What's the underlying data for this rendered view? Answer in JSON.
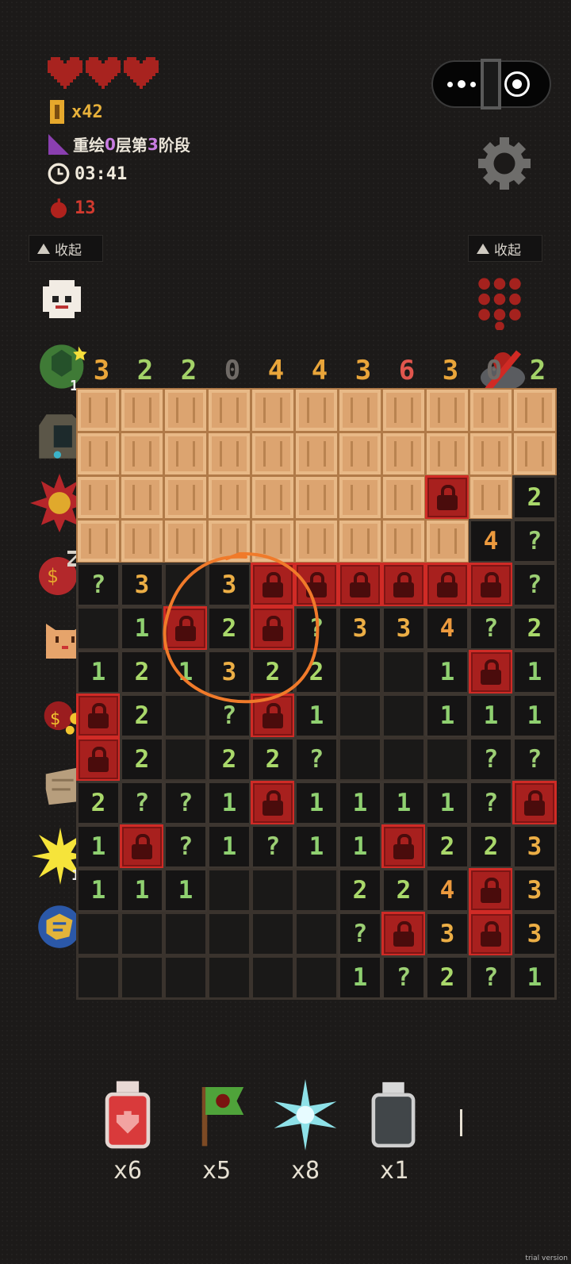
{
  "hud": {
    "coins": "x42",
    "level_text": [
      "重绘",
      "0",
      "层第",
      "3",
      "阶段"
    ],
    "timer": "03:41",
    "bombs": "13"
  },
  "panels": {
    "left_collapse": "收起",
    "right_collapse": "收起"
  },
  "left_badges": {
    "shield": "1",
    "lightning": "1"
  },
  "column_numbers": [
    "3",
    "2",
    "2",
    "0",
    "4",
    "4",
    "3",
    "6",
    "3",
    "0",
    "2"
  ],
  "column_colors": [
    "#e9a53a",
    "#a3d268",
    "#a3d268",
    "#6f6a66",
    "#e9a53a",
    "#e9a53a",
    "#e9a53a",
    "#e0564d",
    "#e9a53a",
    "#6f6a66",
    "#a3d268"
  ],
  "board": [
    [
      "W",
      "W",
      "W",
      "W",
      "W",
      "W",
      "W",
      "W",
      "W",
      "W",
      "W"
    ],
    [
      "W",
      "W",
      "W",
      "W",
      "W",
      "W",
      "W",
      "W",
      "W",
      "W",
      "W"
    ],
    [
      "W",
      "W",
      "W",
      "W",
      "W",
      "W",
      "W",
      "W",
      "M",
      "W",
      "2"
    ],
    [
      "W",
      "W",
      "W",
      "W",
      "W",
      "W",
      "W",
      "W",
      "W",
      "4",
      "?"
    ],
    [
      "?",
      "3",
      "E",
      "3",
      "M",
      "M",
      "M",
      "M",
      "M",
      "M",
      "?"
    ],
    [
      "E",
      "1",
      "M",
      "2",
      "M",
      "?",
      "3",
      "3",
      "4",
      "?",
      "2"
    ],
    [
      "1",
      "2",
      "1",
      "3",
      "2",
      "2",
      "E",
      "E",
      "1",
      "M",
      "1"
    ],
    [
      "M",
      "2",
      "E",
      "?",
      "M",
      "1",
      "E",
      "E",
      "1",
      "1",
      "1"
    ],
    [
      "M",
      "2",
      "E",
      "2",
      "2",
      "?",
      "E",
      "E",
      "E",
      "?",
      "?"
    ],
    [
      "2",
      "?",
      "?",
      "1",
      "M",
      "1",
      "1",
      "1",
      "1",
      "?",
      "M"
    ],
    [
      "1",
      "M",
      "?",
      "1",
      "?",
      "1",
      "1",
      "M",
      "2",
      "2",
      "3"
    ],
    [
      "1",
      "1",
      "1",
      "E",
      "E",
      "E",
      "2",
      "2",
      "4",
      "M",
      "3"
    ],
    [
      "E",
      "E",
      "E",
      "E",
      "E",
      "E",
      "?",
      "M",
      "3",
      "M",
      "3"
    ],
    [
      "E",
      "E",
      "E",
      "E",
      "E",
      "E",
      "1",
      "?",
      "2",
      "?",
      "1"
    ]
  ],
  "number_colors": {
    "1": "#8fd070",
    "2": "#a9d86a",
    "3": "#ecae45",
    "4": "#ec9a3e",
    "?": "#9ccf74"
  },
  "inventory": [
    {
      "name": "heart-potion",
      "count": "x6"
    },
    {
      "name": "green-flag",
      "count": "x5"
    },
    {
      "name": "ice-star",
      "count": "x8"
    },
    {
      "name": "gray-potion",
      "count": "x1"
    }
  ],
  "footer": {
    "trial": "trial version"
  }
}
